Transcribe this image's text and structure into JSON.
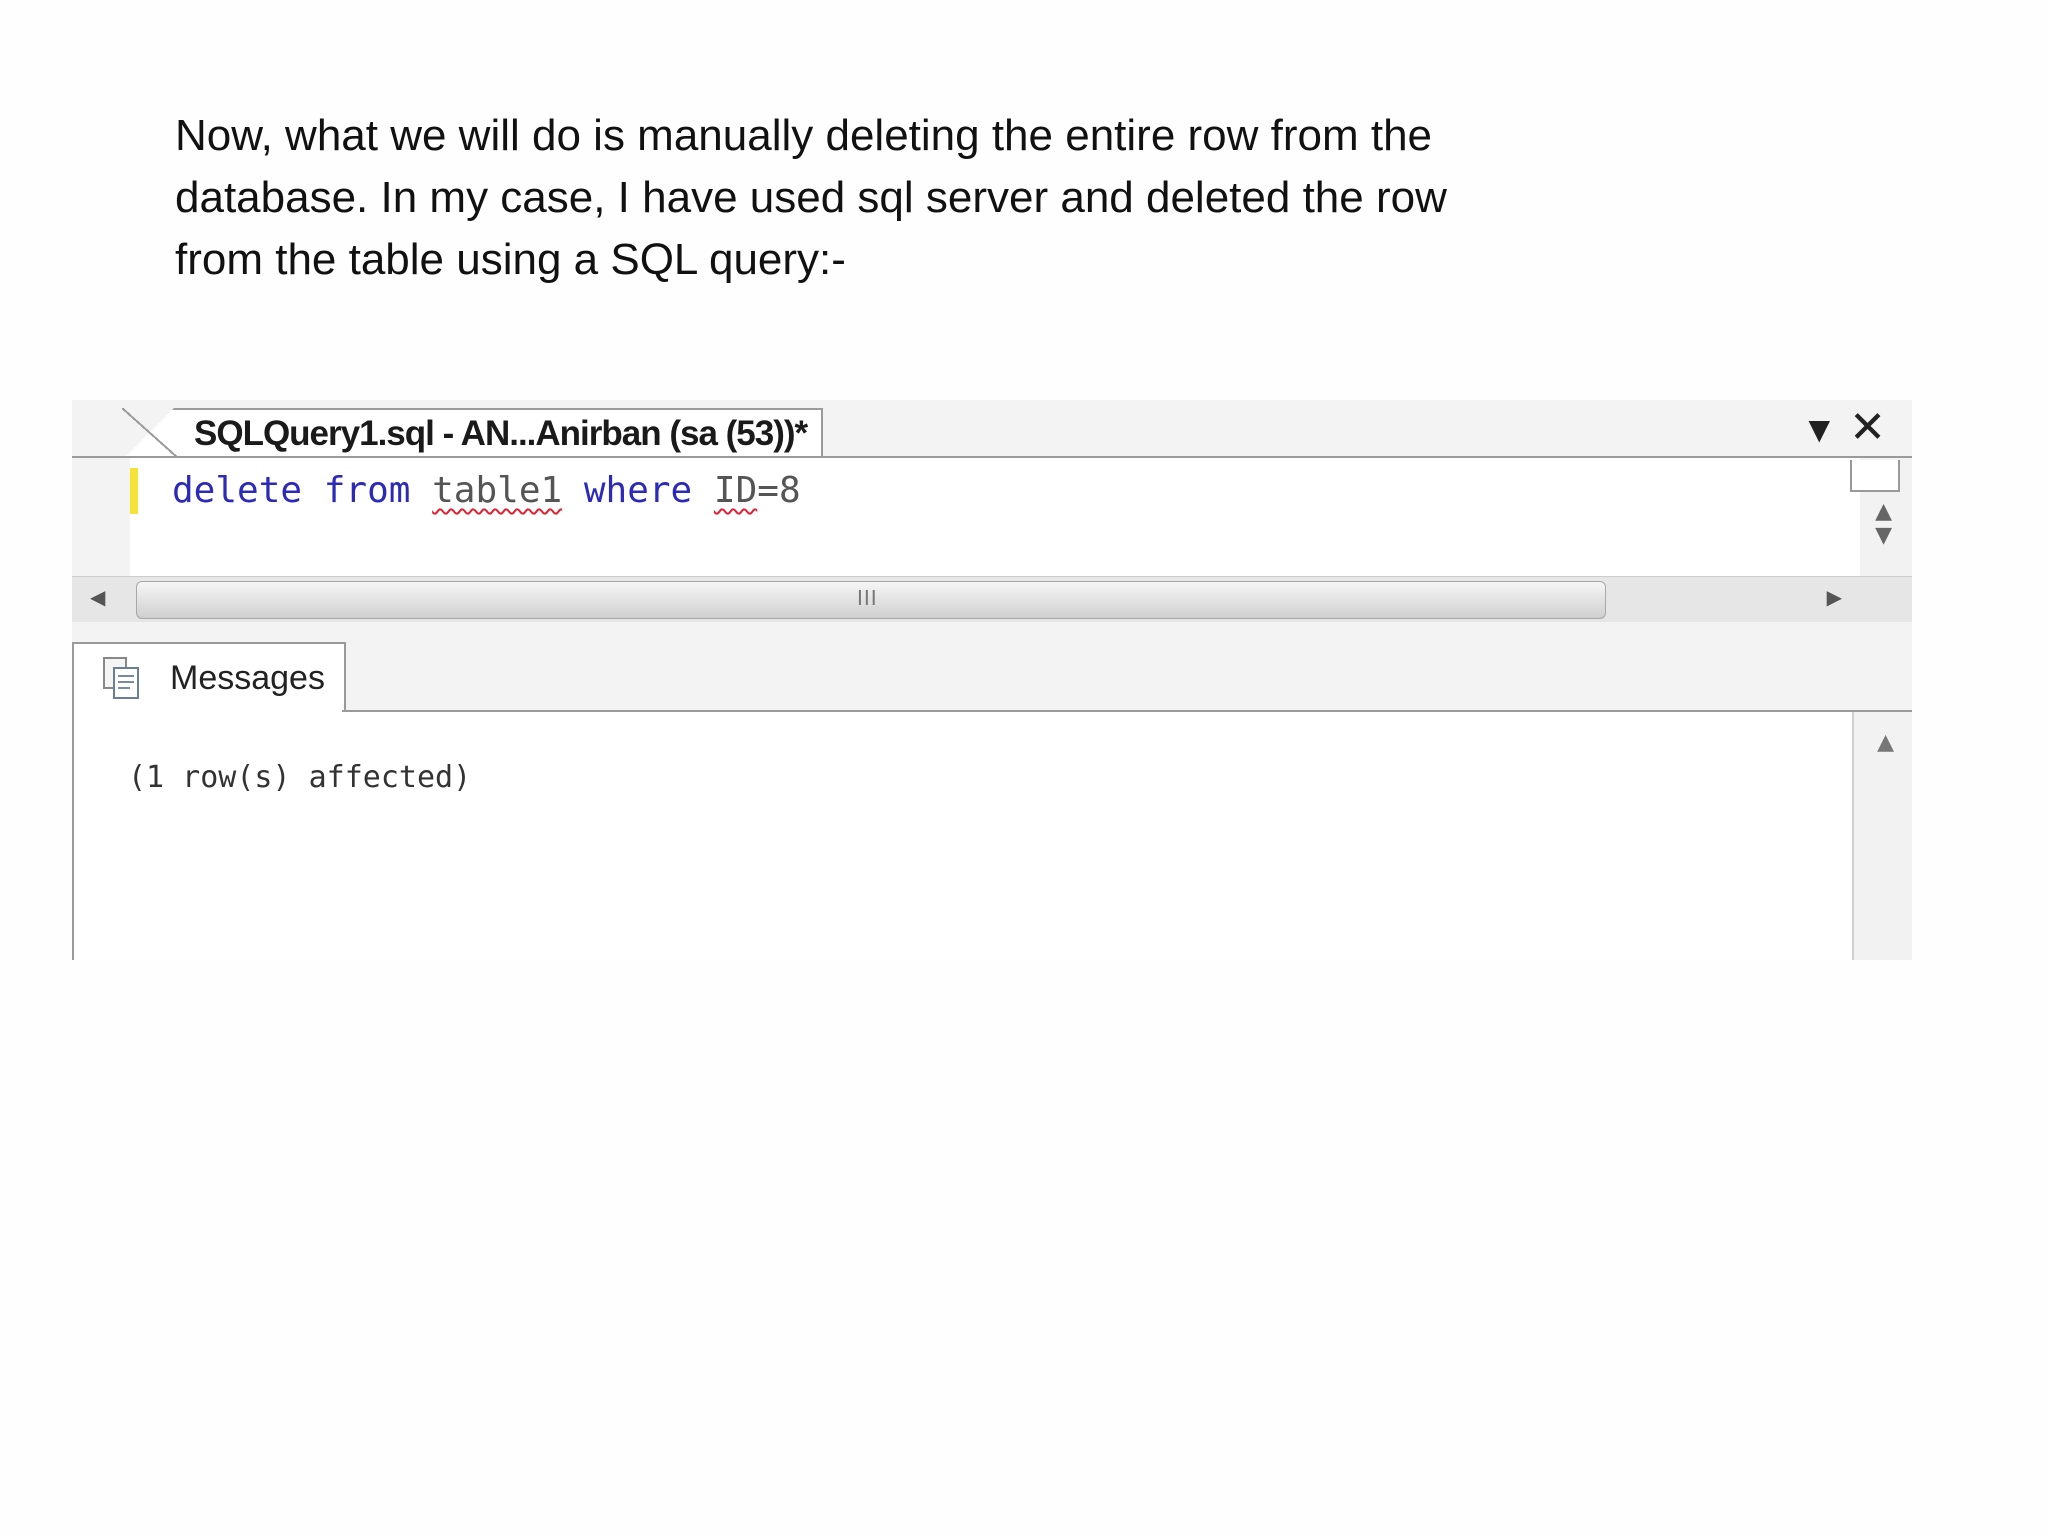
{
  "caption": {
    "line1": "Now, what we will do is manually deleting the entire row from the",
    "line2": "database. In my case, I have used sql server and deleted the row",
    "line3": "from the table using a SQL query:-"
  },
  "query_tab": {
    "title": "SQLQuery1.sql - AN...Anirban (sa (53))*"
  },
  "editor": {
    "tokens": [
      "delete",
      "from",
      "table1",
      "where",
      "ID",
      "=8"
    ]
  },
  "results": {
    "tab_label": "Messages",
    "message": "(1 row(s) affected)"
  },
  "scrollbar": {
    "grip": "III"
  },
  "icons": {
    "dropdown": "chevron-down-icon",
    "close": "close-icon",
    "messages": "messages-icon"
  }
}
